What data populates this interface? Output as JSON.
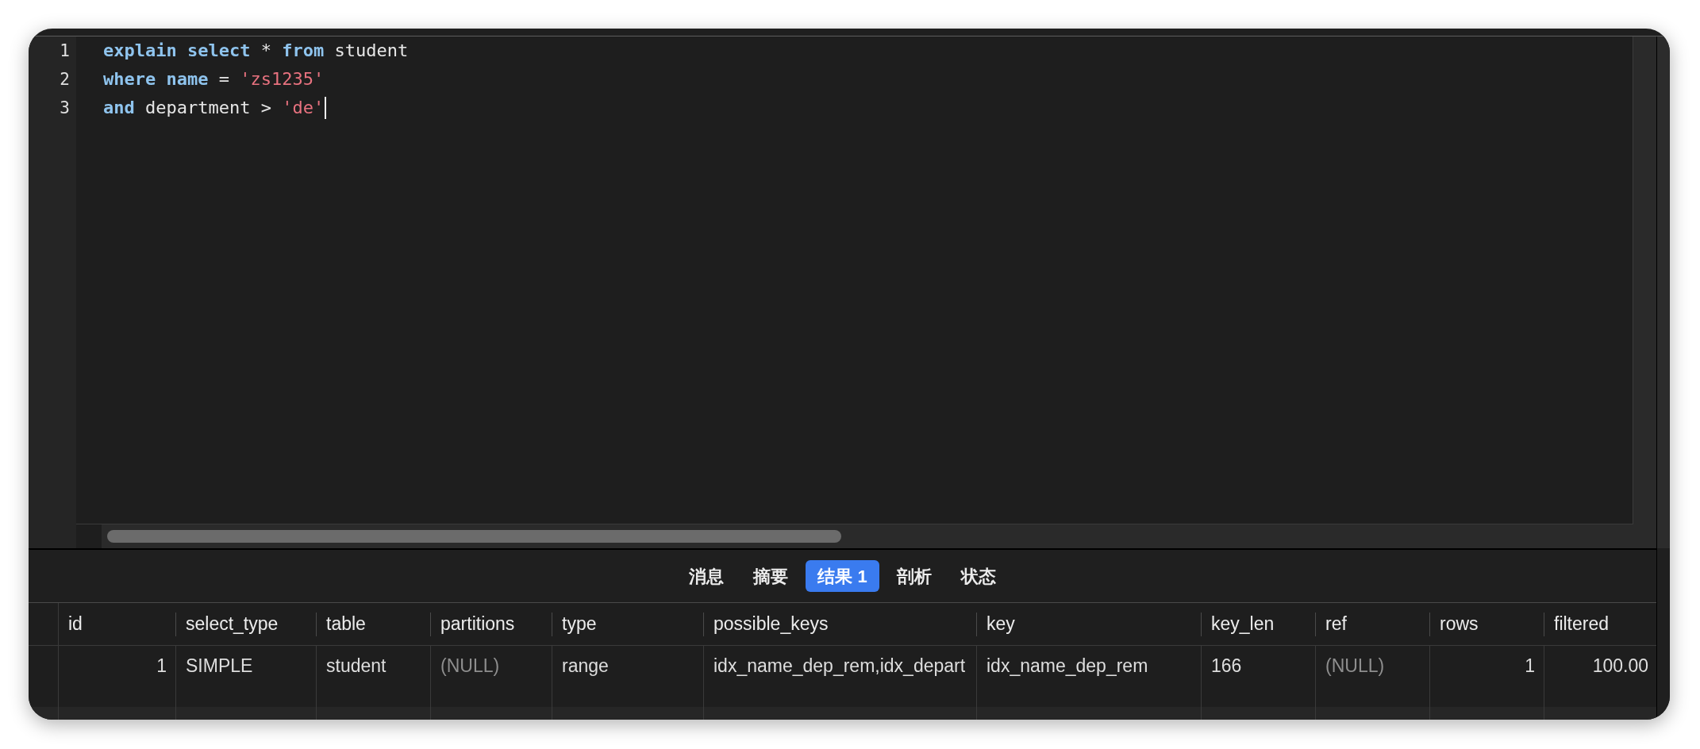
{
  "editor": {
    "lines": [
      {
        "number": "1",
        "cursor": false,
        "tokens": [
          {
            "kind": "keyword",
            "text": "explain "
          },
          {
            "kind": "keyword",
            "text": "select"
          },
          {
            "kind": "plain",
            "text": " * "
          },
          {
            "kind": "keyword",
            "text": "from"
          },
          {
            "kind": "plain",
            "text": " student"
          }
        ]
      },
      {
        "number": "2",
        "cursor": false,
        "tokens": [
          {
            "kind": "keyword",
            "text": "where "
          },
          {
            "kind": "keyword",
            "text": "name"
          },
          {
            "kind": "plain",
            "text": " = "
          },
          {
            "kind": "string",
            "text": "'zs1235'"
          }
        ]
      },
      {
        "number": "3",
        "cursor": true,
        "tokens": [
          {
            "kind": "keyword",
            "text": "and"
          },
          {
            "kind": "plain",
            "text": " department > "
          },
          {
            "kind": "string",
            "text": "'de'"
          }
        ]
      }
    ]
  },
  "result_tabs": [
    {
      "label": "消息",
      "selected": false
    },
    {
      "label": "摘要",
      "selected": false
    },
    {
      "label": "结果 1",
      "selected": true
    },
    {
      "label": "剖析",
      "selected": false
    },
    {
      "label": "状态",
      "selected": false
    }
  ],
  "result_table": {
    "columns": [
      "id",
      "select_type",
      "table",
      "partitions",
      "type",
      "possible_keys",
      "key",
      "key_len",
      "ref",
      "rows",
      "filtered"
    ],
    "rows": [
      [
        {
          "kind": "number",
          "text": "1"
        },
        {
          "kind": "text",
          "text": "SIMPLE"
        },
        {
          "kind": "text",
          "text": "student"
        },
        {
          "kind": "null",
          "text": "(NULL)"
        },
        {
          "kind": "text",
          "text": "range"
        },
        {
          "kind": "text",
          "text": "idx_name_dep_rem,idx_depart"
        },
        {
          "kind": "text",
          "text": "idx_name_dep_rem"
        },
        {
          "kind": "text",
          "text": "166"
        },
        {
          "kind": "null",
          "text": "(NULL)"
        },
        {
          "kind": "number",
          "text": "1"
        },
        {
          "kind": "number",
          "text": "100.00"
        }
      ]
    ]
  }
}
